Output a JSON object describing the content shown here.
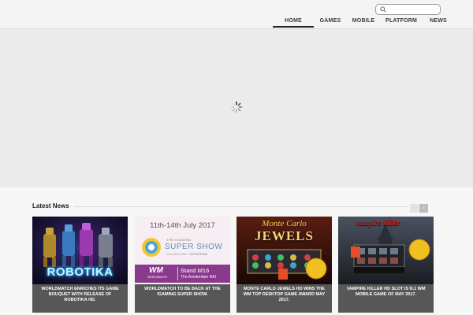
{
  "search": {
    "value": "",
    "placeholder": ""
  },
  "nav": {
    "items": [
      {
        "label": "HOME",
        "active": true
      },
      {
        "label": "GAMES"
      },
      {
        "label": "MOBILE"
      },
      {
        "label": "PLATFORM"
      },
      {
        "label": "NEWS"
      }
    ]
  },
  "news": {
    "title": "Latest News",
    "prev_label": "‹",
    "next_label": "›",
    "cards": [
      {
        "image_text": "ROBOTIKA",
        "caption": "WORLDMATCH ENRICHES ITS GAME BOUQUET WITH RELEASE OF ROBOTIKA HD."
      },
      {
        "image_date": "11th-14th July 2017",
        "image_small": "THE iGAMING",
        "image_show": "SUPER SHOW",
        "image_sub": "11-14 JULY 2017 · AMSTERDAM",
        "image_logo": "WM",
        "image_logo_sub": "WORLDMATCH",
        "image_stand": "Stand M16",
        "image_venue": "The Amsterdam RAI",
        "caption": "WORLDMATCH TO BE BACK AT THE IGAMING SUPER SHOW."
      },
      {
        "image_title1": "Monte Carlo",
        "image_title2": "JEWELS",
        "caption": "MONTE CARLO JEWELS HD WINS THE WM TOP DESKTOP GAME AWARD MAY 2017."
      },
      {
        "image_title": "vampire killer",
        "caption": "VAMPIRE KILLER HD SLOT IS N.1 WM MOBILE GAME OF MAY 2017."
      }
    ]
  },
  "colors": {
    "caption_bg": "#575757",
    "accent_purple": "#8a3a8c",
    "nav_active": "#222222"
  }
}
